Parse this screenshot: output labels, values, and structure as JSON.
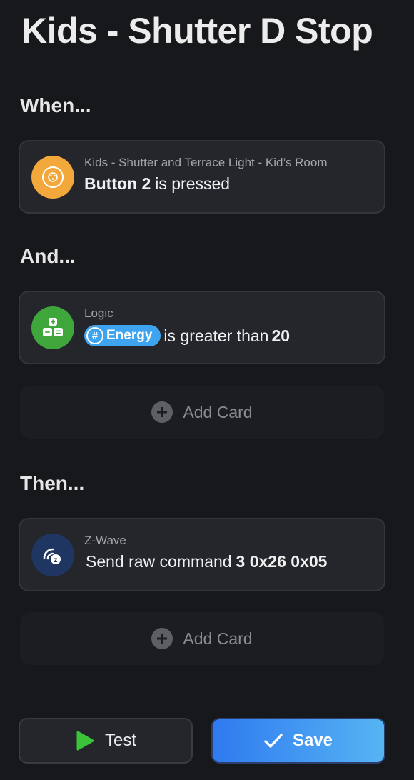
{
  "title": "Kids - Shutter D Stop",
  "sections": {
    "when": "When...",
    "and": "And...",
    "then": "Then..."
  },
  "when_card": {
    "source": "Kids - Shutter and Terrace Light - Kid’s Room",
    "bold_part": "Button 2",
    "rest": "is pressed",
    "icon": "wall-switch-icon",
    "icon_bg": "#f2a83a"
  },
  "and_card": {
    "source": "Logic",
    "token": "Energy",
    "middle": "is greater than",
    "value": "20",
    "icon": "logic-icon",
    "icon_bg": "#3ea63a",
    "token_color": "#3fa4f0"
  },
  "then_card": {
    "source": "Z-Wave",
    "text": "Send raw command",
    "value": "3 0x26 0x05",
    "icon": "zwave-icon",
    "icon_bg": "#1f3562"
  },
  "add_card_label": "Add Card",
  "buttons": {
    "test": "Test",
    "save": "Save"
  },
  "colors": {
    "background": "#17181c",
    "card": "#25262b",
    "save_gradient_start": "#2f7af0",
    "save_gradient_end": "#56b4f3",
    "test_play": "#3bc43a"
  }
}
